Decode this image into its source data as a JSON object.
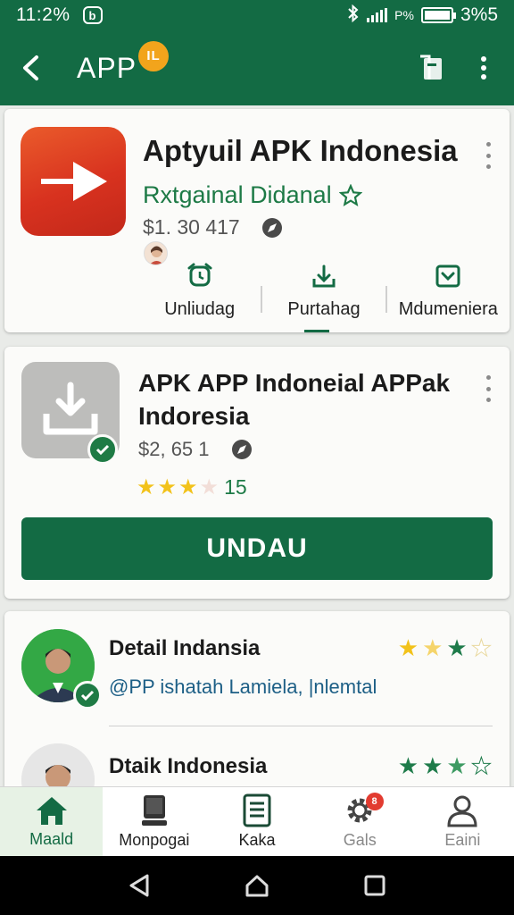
{
  "status_bar": {
    "time": "11:2%",
    "notif_glyph": "b",
    "carrier": "P%",
    "battery": "3%5"
  },
  "app_bar": {
    "title": "APP",
    "badge": "IL"
  },
  "featured": {
    "title": "Aptyuil APK Indonesia",
    "subtitle": "Rxtgainal Didanal",
    "price": "$1. 30 417",
    "actions": [
      {
        "label": "Unliudag",
        "icon": "alarm-icon"
      },
      {
        "label": "Purtahag",
        "icon": "share-upload-icon"
      },
      {
        "label": "Mdumeniera",
        "icon": "inbox-download-icon"
      }
    ]
  },
  "app_card": {
    "title": "APK APP Indoneial APPak Indoresia",
    "price": "$2, 65 1",
    "rating": 3,
    "rating_count": "15",
    "install_label": "UNDAU"
  },
  "reviews": [
    {
      "name": "Detail Indansia",
      "text": "@PP ishatah Lamiela, |nlemtal",
      "stars": 3
    },
    {
      "name": "Dtaik Indonesia",
      "text": "",
      "stars": 3
    }
  ],
  "bottom_nav": [
    {
      "label": "Maald",
      "icon": "home-icon",
      "active": true
    },
    {
      "label": "Monpogai",
      "icon": "monitor-icon"
    },
    {
      "label": "Kaka",
      "icon": "document-list-icon"
    },
    {
      "label": "Gals",
      "icon": "gear-icon",
      "badge": "8"
    },
    {
      "label": "Eaini",
      "icon": "person-icon"
    }
  ],
  "colors": {
    "primary": "#136b44",
    "accent_green": "#1d7a46",
    "badge_orange": "#f2a41c",
    "star_gold": "#f2c21a",
    "icon_red": "#d8321f"
  }
}
